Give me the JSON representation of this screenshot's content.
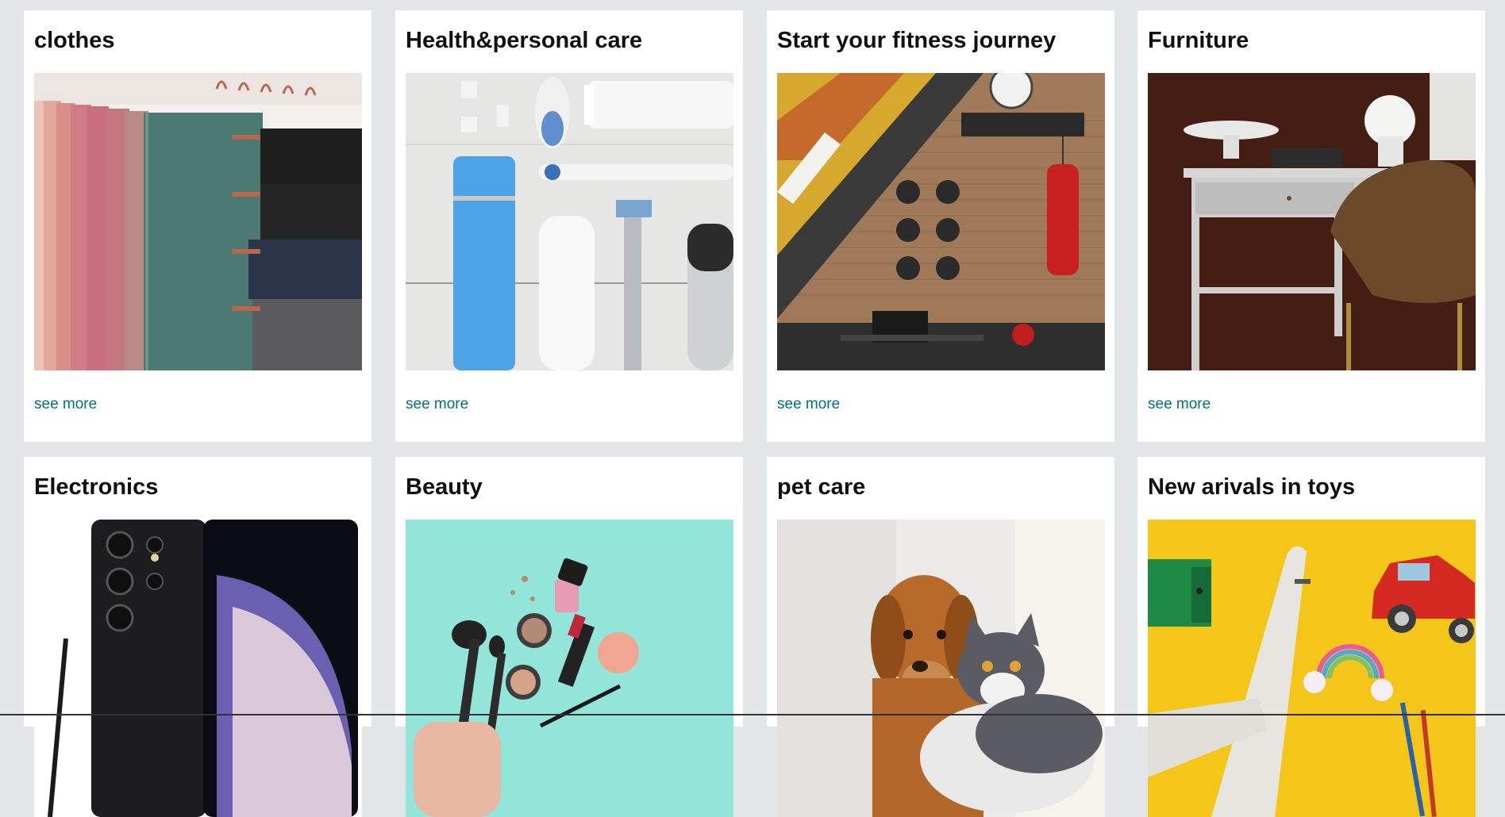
{
  "cards": [
    {
      "title": "clothes",
      "link": "see more",
      "image": "clothes-image"
    },
    {
      "title": "Health&personal care",
      "link": "see more",
      "image": "health-personal-care-image"
    },
    {
      "title": "Start your fitness journey",
      "link": "see more",
      "image": "fitness-gym-image"
    },
    {
      "title": "Furniture",
      "link": "see more",
      "image": "furniture-desk-image"
    },
    {
      "title": "Electronics",
      "image": "smartphone-image"
    },
    {
      "title": "Beauty",
      "image": "makeup-image"
    },
    {
      "title": "pet care",
      "image": "dog-and-cat-image"
    },
    {
      "title": "New arivals in toys",
      "image": "toy-airplane-car-image"
    }
  ],
  "colors": {
    "background": "#e3e6e6",
    "card": "#ffffff",
    "link": "#007185",
    "title": "#0f1111"
  }
}
